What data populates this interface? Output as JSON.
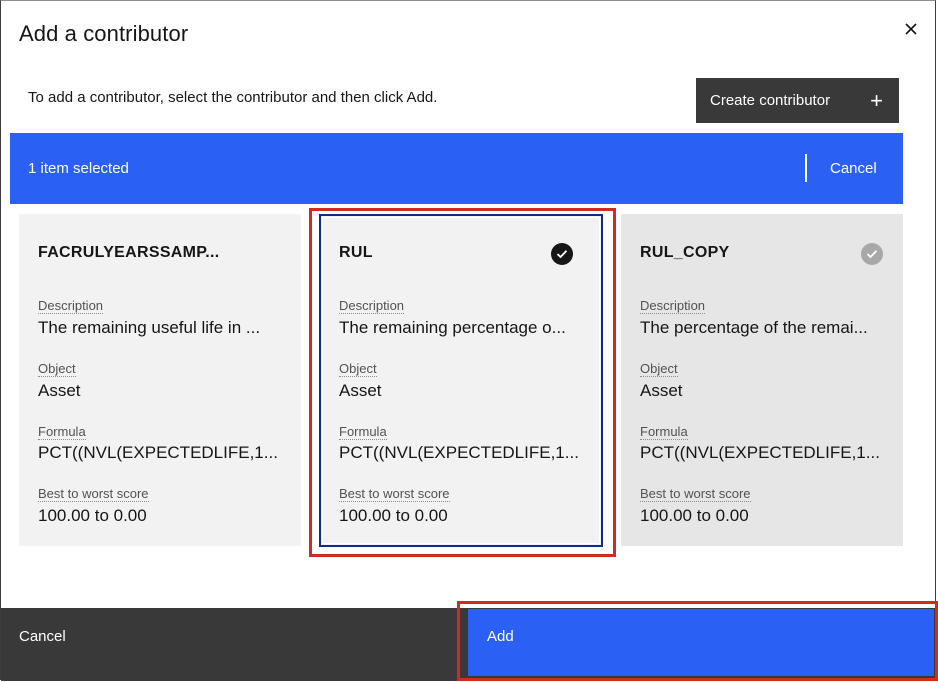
{
  "modal": {
    "title": "Add a contributor",
    "close_icon": "close-icon",
    "instruction": "To add a contributor, select the contributor and then click Add.",
    "create_button_label": "Create contributor",
    "create_button_icon": "+"
  },
  "selection_bar": {
    "count_text": "1 item selected",
    "cancel_label": "Cancel",
    "color": "#2b60f5"
  },
  "tiles": [
    {
      "name": "FACRULYEARSSAMP...",
      "selected": false,
      "description_label": "Description",
      "description": "The remaining useful life in ...",
      "object_label": "Object",
      "object": "Asset",
      "formula_label": "Formula",
      "formula": "PCT((NVL(EXPECTEDLIFE,1...",
      "score_label": "Best to worst score",
      "score": "100.00 to 0.00"
    },
    {
      "name": "RUL",
      "selected": true,
      "description_label": "Description",
      "description": "The remaining percentage o...",
      "object_label": "Object",
      "object": "Asset",
      "formula_label": "Formula",
      "formula": "PCT((NVL(EXPECTEDLIFE,1...",
      "score_label": "Best to worst score",
      "score": "100.00 to 0.00"
    },
    {
      "name": "RUL_COPY",
      "selected": false,
      "disabled_check": true,
      "description_label": "Description",
      "description": "The percentage of the remai...",
      "object_label": "Object",
      "object": "Asset",
      "formula_label": "Formula",
      "formula": "PCT((NVL(EXPECTEDLIFE,1...",
      "score_label": "Best to worst score",
      "score": "100.00 to 0.00"
    }
  ],
  "footer": {
    "cancel_label": "Cancel",
    "add_label": "Add",
    "primary_color": "#2b60f5",
    "secondary_color": "#393939"
  },
  "annotation_color": "#d32a1f"
}
